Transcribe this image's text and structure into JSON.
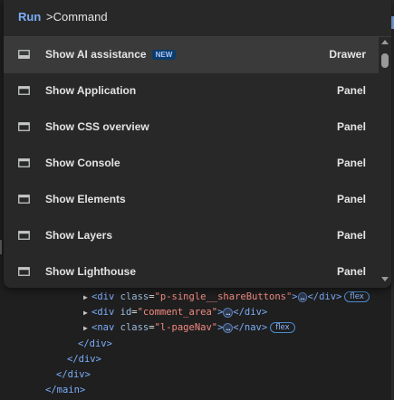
{
  "command_menu": {
    "mode_label": "Run",
    "query": ">Command",
    "items": [
      {
        "label": "Show AI assistance",
        "badge": "NEW",
        "category": "Drawer",
        "icon": "drawer-icon",
        "selected": true
      },
      {
        "label": "Show Application",
        "category": "Panel",
        "icon": "panel-icon"
      },
      {
        "label": "Show CSS overview",
        "category": "Panel",
        "icon": "panel-icon"
      },
      {
        "label": "Show Console",
        "category": "Panel",
        "icon": "panel-icon"
      },
      {
        "label": "Show Elements",
        "category": "Panel",
        "icon": "panel-icon"
      },
      {
        "label": "Show Layers",
        "category": "Panel",
        "icon": "panel-icon"
      },
      {
        "label": "Show Lighthouse",
        "category": "Panel",
        "icon": "panel-icon"
      }
    ]
  },
  "dom_tree": {
    "ellipsis": "…",
    "flex_badge": "flex",
    "line1": {
      "open_tag": "<div",
      "attr": "class",
      "value": "\"p-single__shareButtons\"",
      "gt": ">",
      "close_tag": "</div>"
    },
    "line2": {
      "open_tag": "<div",
      "attr": "id",
      "value": "\"comment_area\"",
      "gt": ">",
      "close_tag": "</div>"
    },
    "line3": {
      "open_tag": "<nav",
      "attr": "class",
      "value": "\"l-pageNav\"",
      "gt": ">",
      "close_tag": "</nav>"
    },
    "close1": "</div>",
    "close2": "</div>",
    "close3": "</div>",
    "close4": "</main>"
  },
  "colors": {
    "accent": "#7cacf8",
    "palette_bg": "#282828",
    "selected_bg": "#3a3a3a",
    "badge_bg": "#0b3c6b"
  }
}
